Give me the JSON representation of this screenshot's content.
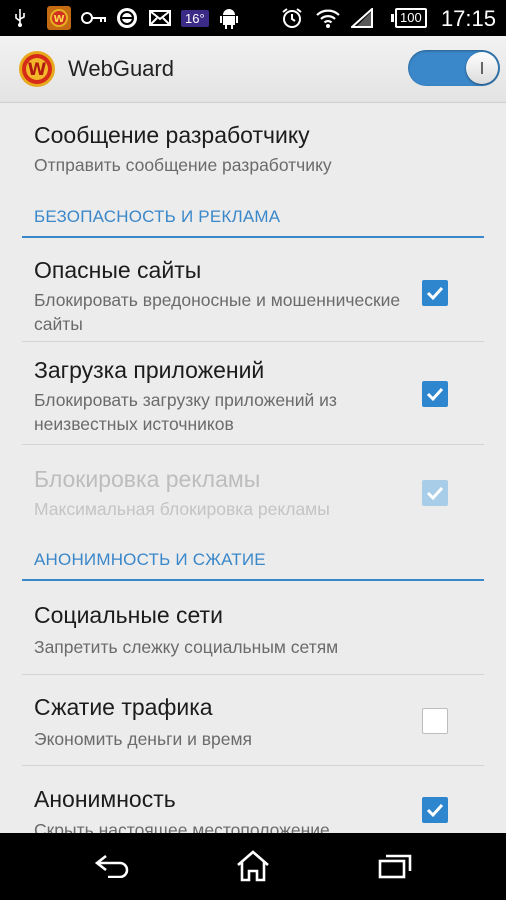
{
  "status_bar": {
    "temperature": "16°",
    "battery": "100",
    "time": "17:15",
    "icons": [
      "usb-icon",
      "webguard-notification-icon",
      "key-icon",
      "sync-icon",
      "mail-icon",
      "temperature-badge",
      "android-icon",
      "alarm-icon",
      "wifi-icon",
      "signal-icon",
      "battery-icon"
    ]
  },
  "action_bar": {
    "title": "WebGuard",
    "toggle_on": true
  },
  "developer_message": {
    "title": "Сообщение разработчику",
    "subtitle": "Отправить сообщение разработчику"
  },
  "sections": [
    {
      "header": "БЕЗОПАСНОСТЬ И РЕКЛАМА",
      "items": [
        {
          "title": "Опасные сайты",
          "subtitle": "Блокировать вредоносные и мошеннические сайты",
          "checked": true,
          "enabled": true
        },
        {
          "title": "Загрузка приложений",
          "subtitle": "Блокировать загрузку приложений из неизвестных источников",
          "checked": true,
          "enabled": true
        },
        {
          "title": "Блокировка рекламы",
          "subtitle": "Максимальная блокировка рекламы",
          "checked": true,
          "enabled": false
        }
      ]
    },
    {
      "header": "АНОНИМНОСТЬ И СЖАТИЕ",
      "items": [
        {
          "title": "Социальные сети",
          "subtitle": "Запретить слежку социальным сетям"
        },
        {
          "title": "Сжатие трафика",
          "subtitle": "Экономить деньги и время",
          "checked": false,
          "enabled": true
        },
        {
          "title": "Анонимность",
          "subtitle": "Скрыть настоящее местоположение",
          "checked": true,
          "enabled": true
        }
      ]
    }
  ],
  "nav_bar": {
    "buttons": [
      "back-icon",
      "home-icon",
      "recent-apps-icon"
    ]
  },
  "colors": {
    "accent": "#3a87c9",
    "checkbox_checked": "#2e86cf",
    "background": "#ececec"
  }
}
